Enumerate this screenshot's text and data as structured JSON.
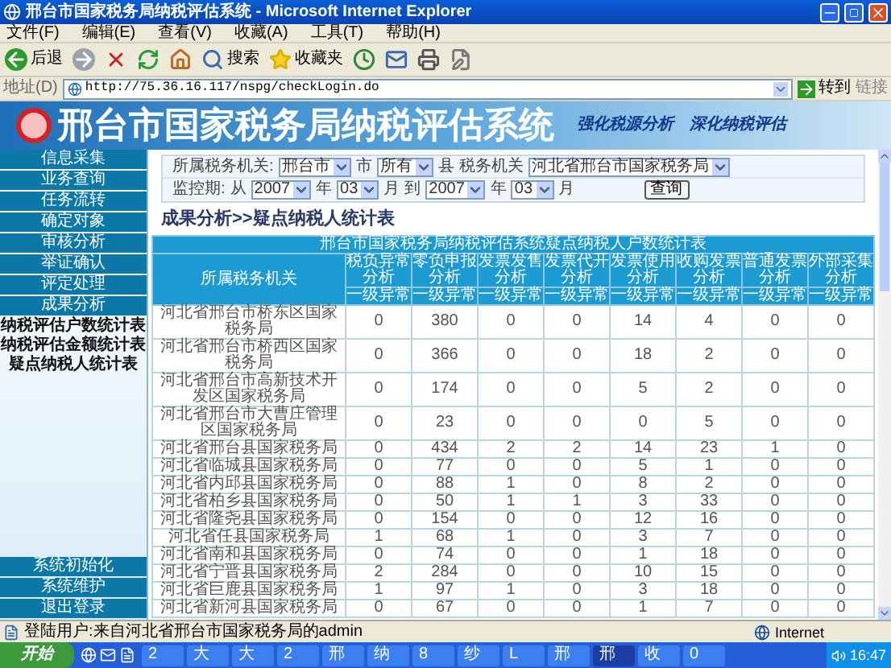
{
  "window": {
    "title": "邢台市国家税务局纳税评估系统 - Microsoft Internet Explorer"
  },
  "menu": [
    "文件(F)",
    "编辑(E)",
    "查看(V)",
    "收藏(A)",
    "工具(T)",
    "帮助(H)"
  ],
  "toolbar": [
    {
      "kind": "back",
      "label": "后退"
    },
    {
      "kind": "forward"
    },
    {
      "kind": "stop"
    },
    {
      "kind": "refresh"
    },
    {
      "kind": "home"
    },
    {
      "kind": "search",
      "label": "搜索"
    },
    {
      "kind": "favorites",
      "label": "收藏夹"
    },
    {
      "kind": "history"
    },
    {
      "kind": "mail"
    },
    {
      "kind": "print"
    },
    {
      "kind": "edit"
    }
  ],
  "address_bar": {
    "label": "地址(D)",
    "url": "http://75.36.16.117/nspg/checkLogin.do",
    "go": "转到",
    "links": "链接"
  },
  "banner": {
    "title": "邢台市国家税务局纳税评估系统",
    "slogan": [
      "强化税源分析",
      "深化纳税评估"
    ]
  },
  "sidebar": {
    "items": [
      "信息采集",
      "业务查询",
      "任务流转",
      "确定对象",
      "审核分析",
      "举证确认",
      "评定处理",
      "成果分析"
    ],
    "links": [
      "纳税评估户数统计表",
      "纳税评估金额统计表",
      "疑点纳税人统计表"
    ],
    "bottom_items": [
      "系统初始化",
      "系统维护",
      "退出登录"
    ]
  },
  "filter": {
    "rows": [
      {
        "items": [
          {
            "kind": "label",
            "text": "所属税务机关:"
          },
          {
            "kind": "select",
            "value": "邢台市"
          },
          {
            "kind": "label",
            "text": "市"
          },
          {
            "kind": "select",
            "value": "所有"
          },
          {
            "kind": "label",
            "text": "县"
          },
          {
            "kind": "label",
            "text": "税务机关"
          },
          {
            "kind": "select",
            "value": "河北省邢台市国家税务局"
          }
        ]
      },
      {
        "items": [
          {
            "kind": "label",
            "text": "监控期:"
          },
          {
            "kind": "label",
            "text": "从"
          },
          {
            "kind": "select",
            "value": "2007"
          },
          {
            "kind": "label",
            "text": "年"
          },
          {
            "kind": "select",
            "value": "03"
          },
          {
            "kind": "label",
            "text": "月"
          },
          {
            "kind": "label",
            "text": "到"
          },
          {
            "kind": "select",
            "value": "2007"
          },
          {
            "kind": "label",
            "text": "年"
          },
          {
            "kind": "select",
            "value": "03"
          },
          {
            "kind": "label",
            "text": "月"
          },
          {
            "kind": "button",
            "text": "查询"
          }
        ]
      }
    ]
  },
  "breadcrumb": "成果分析>>疑点纳税人统计表",
  "table": {
    "title": "邢台市国家税务局纳税评估系统疑点纳税人户数统计表",
    "columns": [
      "所属税务机关",
      "税负异常分析",
      "零负申报分析",
      "发票发售分析",
      "发票代开分析",
      "发票使用分析",
      "收购发票分析",
      "普通发票分析",
      "外部采集分析"
    ],
    "subheader": [
      "一级异常",
      "一级异常",
      "一级异常",
      "一级异常",
      "一级异常",
      "一级异常",
      "一级异常",
      "一级异常"
    ],
    "rows": [
      [
        "河北省邢台市桥东区国家税务局",
        "0",
        "380",
        "0",
        "0",
        "14",
        "4",
        "0",
        "0"
      ],
      [
        "河北省邢台市桥西区国家税务局",
        "0",
        "366",
        "0",
        "0",
        "18",
        "2",
        "0",
        "0"
      ],
      [
        "河北省邢台市高新技术开发区国家税务局",
        "0",
        "174",
        "0",
        "0",
        "5",
        "2",
        "0",
        "0"
      ],
      [
        "河北省邢台市大曹庄管理区国家税务局",
        "0",
        "23",
        "0",
        "0",
        "0",
        "5",
        "0",
        "0"
      ],
      [
        "河北省邢台县国家税务局",
        "0",
        "434",
        "2",
        "2",
        "14",
        "23",
        "1",
        "0"
      ],
      [
        "河北省临城县国家税务局",
        "0",
        "77",
        "0",
        "0",
        "5",
        "1",
        "0",
        "0"
      ],
      [
        "河北省内邱县国家税务局",
        "0",
        "88",
        "1",
        "0",
        "8",
        "2",
        "0",
        "0"
      ],
      [
        "河北省柏乡县国家税务局",
        "0",
        "50",
        "1",
        "1",
        "3",
        "33",
        "0",
        "0"
      ],
      [
        "河北省隆尧县国家税务局",
        "0",
        "154",
        "0",
        "0",
        "12",
        "16",
        "0",
        "0"
      ],
      [
        "河北省任县国家税务局",
        "1",
        "68",
        "1",
        "0",
        "3",
        "7",
        "0",
        "0"
      ],
      [
        "河北省南和县国家税务局",
        "0",
        "74",
        "0",
        "0",
        "1",
        "18",
        "0",
        "0"
      ],
      [
        "河北省宁晋县国家税务局",
        "2",
        "284",
        "0",
        "0",
        "10",
        "15",
        "0",
        "0"
      ],
      [
        "河北省巨鹿县国家税务局",
        "1",
        "97",
        "1",
        "0",
        "3",
        "18",
        "0",
        "0"
      ],
      [
        "河北省新河县国家税务局",
        "0",
        "67",
        "0",
        "0",
        "1",
        "7",
        "0",
        "0"
      ]
    ]
  },
  "status_bar": {
    "text": "登陆用户:来自河北省邢台市国家税务局的admin",
    "zone": "Internet"
  },
  "taskbar": {
    "start": "开始",
    "buttons": [
      {
        "label": "2",
        "selected": false
      },
      {
        "label": "大",
        "selected": false
      },
      {
        "label": "大",
        "selected": false
      },
      {
        "label": "2",
        "selected": false
      },
      {
        "label": "邢",
        "selected": false
      },
      {
        "label": "纳",
        "selected": false
      },
      {
        "label": "8",
        "selected": false
      },
      {
        "label": "纱",
        "selected": false
      },
      {
        "label": "L",
        "selected": false
      },
      {
        "label": "邢",
        "selected": false
      },
      {
        "label": "邢",
        "selected": true
      },
      {
        "label": "收",
        "selected": false
      },
      {
        "label": "0",
        "selected": false
      }
    ],
    "clock": "16:47"
  }
}
